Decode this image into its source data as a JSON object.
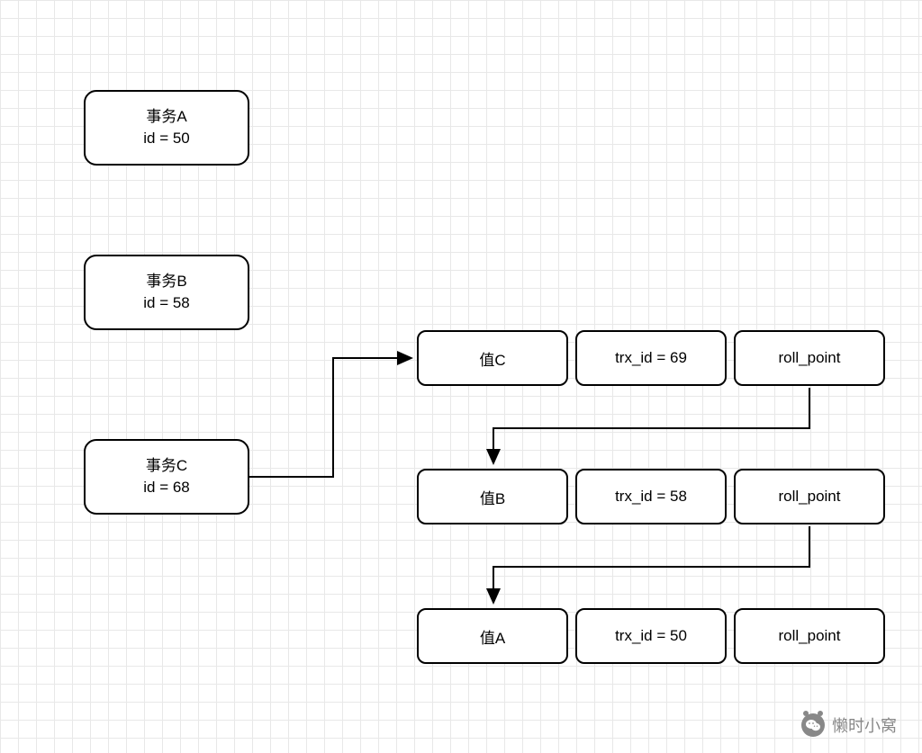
{
  "transactions": {
    "a": {
      "title": "事务A",
      "id_line": "id = 50"
    },
    "b": {
      "title": "事务B",
      "id_line": "id = 58"
    },
    "c": {
      "title": "事务C",
      "id_line": "id = 68"
    }
  },
  "rows": {
    "r1": {
      "value": "值C",
      "trx": "trx_id = 69",
      "roll": "roll_point"
    },
    "r2": {
      "value": "值B",
      "trx": "trx_id = 58",
      "roll": "roll_point"
    },
    "r3": {
      "value": "值A",
      "trx": "trx_id = 50",
      "roll": "roll_point"
    }
  },
  "watermark": {
    "text": "懒时小窝"
  }
}
